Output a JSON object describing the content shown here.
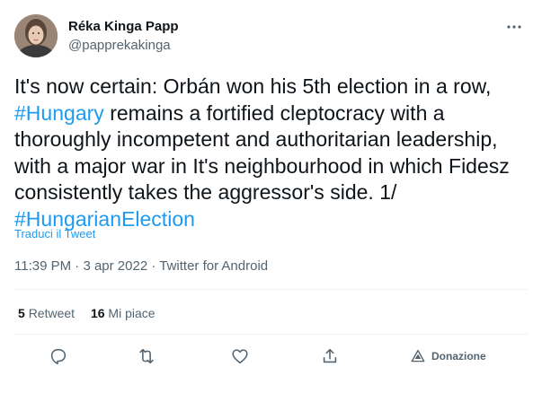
{
  "author": {
    "display_name": "Réka Kinga Papp",
    "handle": "@papprekakinga"
  },
  "tweet": {
    "lines": [
      [
        {
          "t": "It's now certain: Orbán won his 5th election in a row,",
          "tag": false
        }
      ],
      [
        {
          "t": "#Hungary",
          "tag": true
        },
        {
          "t": " remains a fortified cleptocracy with a",
          "tag": false
        }
      ],
      [
        {
          "t": "thoroughly incompetent and authoritarian leadership,",
          "tag": false
        }
      ],
      [
        {
          "t": "with a major war in It's neighbourhood in which Fidesz",
          "tag": false
        }
      ],
      [
        {
          "t": "consistently takes the aggressor's side. 1/",
          "tag": false
        }
      ],
      [
        {
          "t": "#HungarianElection",
          "tag": true
        }
      ]
    ],
    "hashtag_color": "#1d9bf0"
  },
  "translate_label": "Traduci il Tweet",
  "meta": {
    "time": "11:39 PM",
    "separator": " · ",
    "date": "3 apr 2022",
    "source": "Twitter for Android"
  },
  "stats": {
    "retweets_count": "5",
    "retweets_label": "Retweet",
    "likes_count": "16",
    "likes_label": "Mi piace"
  },
  "actions": {
    "reply_icon": "reply-icon",
    "retweet_icon": "retweet-icon",
    "like_icon": "heart-icon",
    "share_icon": "share-icon",
    "donate_icon": "donate-icon",
    "donate_label": "Donazione"
  },
  "colors": {
    "text": "#0f1419",
    "secondary": "#536471",
    "accent": "#1d9bf0",
    "divider": "#eff3f4"
  }
}
